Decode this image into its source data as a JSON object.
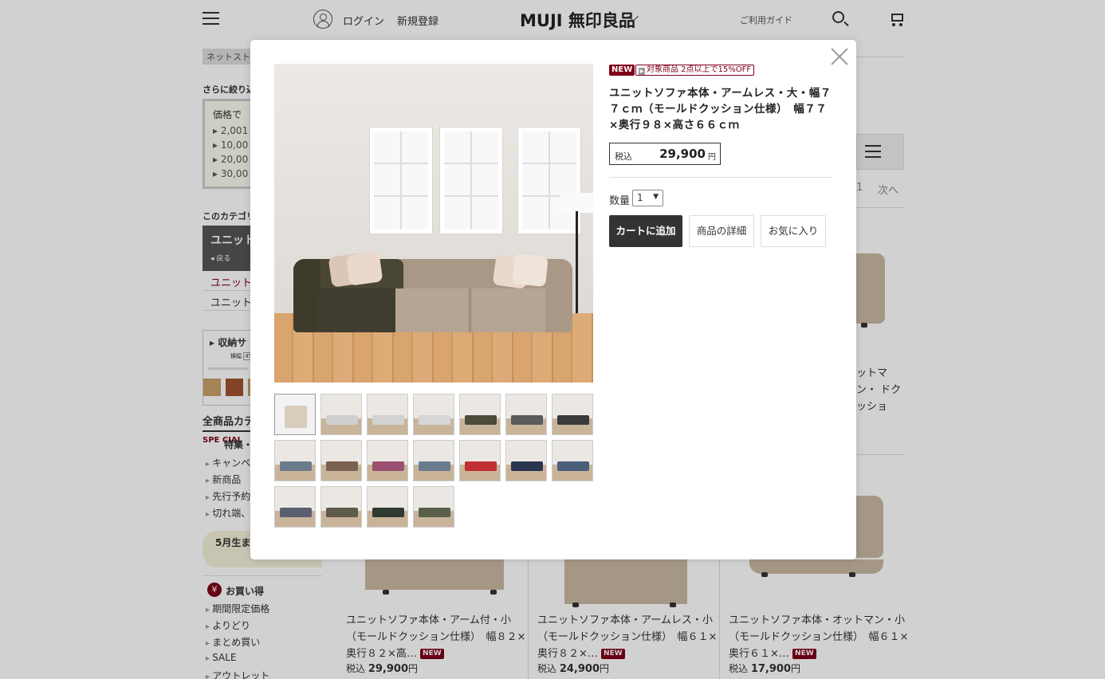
{
  "header": {
    "login": "ログイン",
    "register": "新規登録",
    "logo": "MUJI 無印良品",
    "guide": "ご利用ガイド"
  },
  "sidebar": {
    "breadcrumb": "ネットストア",
    "refine_title": "さらに絞り込",
    "price_title": "価格で",
    "price_ranges": [
      "2,001",
      "10,00",
      "20,00",
      "30,00"
    ],
    "category_title": "このカテゴリ",
    "current_category": "ユニット",
    "back": "戻る",
    "category_items": [
      "ユニット",
      "ユニット"
    ],
    "storage_title": "収納サ",
    "storage_label": "横幅",
    "storage_value": "450",
    "all_categories": "全商品カテ",
    "special_mark": "SPE CIAL",
    "special_title": "特集・",
    "special_links": [
      "キャンペ",
      "新商品",
      "先行予約",
      "切れ端、"
    ],
    "birthday_text": "5月生ま お誕生日",
    "deals_title": "お買い得",
    "deals_links": [
      "期間限定価格",
      "よりどり",
      "まとめ買い",
      "SALE",
      "アウトレット"
    ]
  },
  "pager": {
    "page": "1",
    "next": "次へ"
  },
  "background_products": [
    {
      "title": "ユニットソファ本体・アーム付・小（モールドクッション仕様）　幅８２×奥行８２×高…",
      "badge": "NEW",
      "tax": "税込",
      "price": "29,900",
      "yen": "円"
    },
    {
      "title": "ユニットソファ本体・アームレス・小（モールドクッション仕様）　幅６１×奥行８２×…",
      "badge": "NEW",
      "tax": "税込",
      "price": "24,900",
      "yen": "円"
    },
    {
      "title": "ユニットソファ本体・オットマン・小（モールドクッション仕様）　幅６１×奥行６１×…",
      "badge": "NEW",
      "tax": "税込",
      "price": "17,900",
      "yen": "円"
    }
  ],
  "background_product_partial": "ットマン・ ドクッショ",
  "modal": {
    "badge_new": "NEW",
    "badge_offer": "対象商品 2点以上で15%OFF",
    "title": "ユニットソファ本体・アームレス・大・幅７７ｃｍ（モールドクッション仕様）　幅７７×奥行９８×高さ６６ｃｍ",
    "tax_label": "税込",
    "price": "29,900",
    "yen": "円",
    "qty_label": "数量",
    "qty_value": "1",
    "btn_cart": "カートに追加",
    "btn_detail": "商品の詳細",
    "btn_fav": "お気に入り",
    "thumbnail_count": 18
  },
  "colors": {
    "accent": "#7f0019",
    "button_dark": "#333333"
  }
}
